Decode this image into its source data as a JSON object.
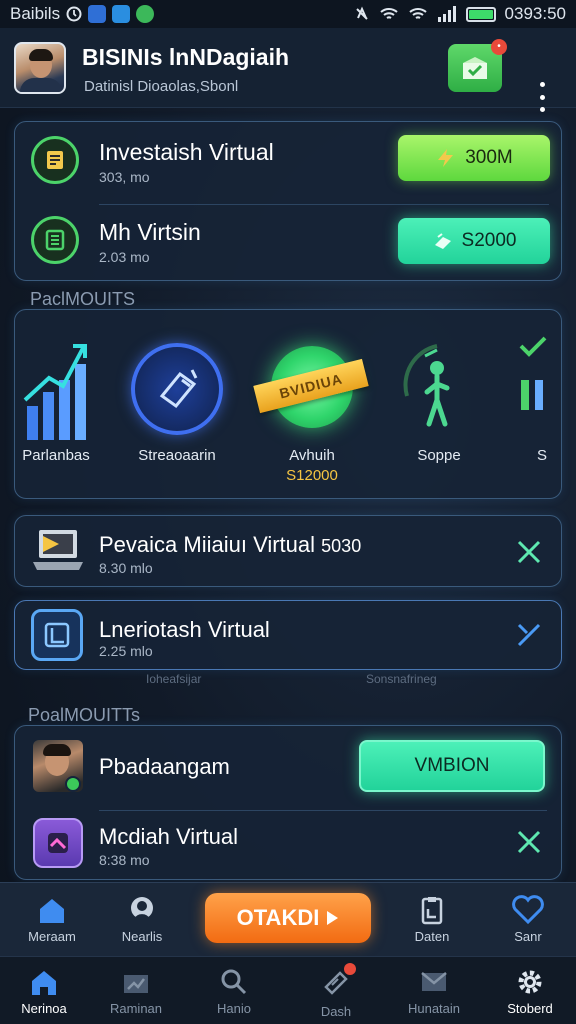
{
  "status_bar": {
    "carrier": "Baibils",
    "time": "0393:50"
  },
  "header": {
    "title": "BISINIs lnNDagiaih",
    "subtitle": "Datinisl Dioaolas,Sbonl"
  },
  "investments": [
    {
      "title": "Investaish Virtual",
      "subtitle": "303, mo",
      "button": "300M"
    },
    {
      "title": "Mh Virtsin",
      "subtitle": "2.03 mo",
      "button": "S2000"
    }
  ],
  "section1_label": "PaclMOUITS",
  "tiles": [
    {
      "label": "Parlanbas",
      "value": ""
    },
    {
      "label": "Streaoaarin",
      "value": ""
    },
    {
      "label": "Avhuih",
      "value": "S12000",
      "ribbon": "BVIDIUA"
    },
    {
      "label": "Soppe",
      "value": ""
    },
    {
      "label": "S",
      "value": ""
    }
  ],
  "list_rows": [
    {
      "title": "Pevaica Miiaiuı Virtual",
      "amount": "5030",
      "subtitle": "8.30 mlo"
    },
    {
      "title": "Lneriotash Virtual",
      "subtitle": "2.25 mlo"
    }
  ],
  "faint_labels": [
    "Ioheafsijar",
    "Sonsnafrineg"
  ],
  "section2_label": "PoalMOUITTs",
  "promo_rows": [
    {
      "title": "Pbadaangam",
      "button": "VMBION"
    },
    {
      "title": "Mcdiah Virtual",
      "subtitle": "8:38 mo"
    }
  ],
  "action_nav": {
    "items": [
      "Meraam",
      "Nearlis",
      "Daten",
      "Sanr"
    ],
    "play_label": "OTAKDI"
  },
  "bottom_nav": {
    "items": [
      "Nerinoa",
      "Raminan",
      "Hanio",
      "Dash",
      "Hunatain",
      "Stoberd"
    ]
  },
  "colors": {
    "accent_green": "#5ed83e",
    "accent_teal": "#22d39a",
    "accent_orange": "#f26b12",
    "accent_blue": "#3f8cf0",
    "ribbon_gold": "#f2b52a",
    "value_gold": "#f5c542"
  }
}
